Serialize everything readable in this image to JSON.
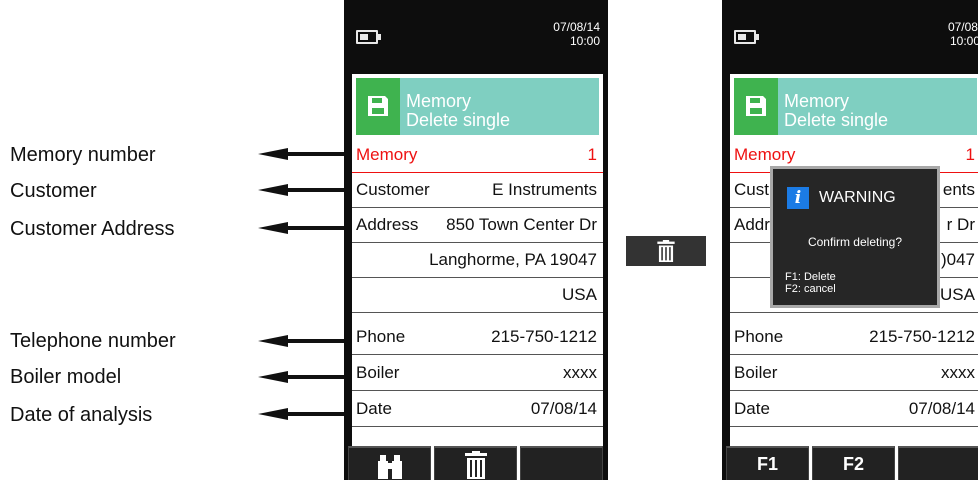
{
  "labels": [
    "Memory number",
    "Customer",
    "Customer Address",
    "Telephone number",
    "Boiler model",
    "Date of analysis"
  ],
  "left_device": {
    "date": "07/08/14",
    "time": "10:00",
    "header_line1": "Memory",
    "header_line2": "Delete single",
    "rows": [
      {
        "key": "Memory",
        "value": "1"
      },
      {
        "key": "Customer",
        "value": "E Instruments"
      },
      {
        "key": "Address",
        "value": "850 Town Center Dr"
      },
      {
        "key": "",
        "value": "Langhorme, PA  19047"
      },
      {
        "key": "",
        "value": "USA"
      },
      {
        "key": "Phone",
        "value": "215-750-1212"
      },
      {
        "key": "Boiler",
        "value": "xxxx"
      },
      {
        "key": "Date",
        "value": "07/08/14"
      }
    ],
    "softkeys": [
      "binoculars-icon",
      "trash-icon",
      ""
    ]
  },
  "middle_button": {
    "icon": "trash-icon"
  },
  "right_device": {
    "date": "07/08/1",
    "time": "10:00",
    "header_line1": "Memory",
    "header_line2": "Delete single",
    "rows": [
      {
        "key": "Memory",
        "value": "1"
      },
      {
        "key": "Cust",
        "value": "ents"
      },
      {
        "key": "Addr",
        "value": "r Dr"
      },
      {
        "key": "",
        "value": ")047"
      },
      {
        "key": "",
        "value": "USA"
      },
      {
        "key": "Phone",
        "value": "215-750-1212"
      },
      {
        "key": "Boiler",
        "value": "xxxx"
      },
      {
        "key": "Date",
        "value": "07/08/14"
      }
    ],
    "softkeys": [
      "F1",
      "F2",
      ""
    ],
    "dialog": {
      "icon": "i",
      "title": "WARNING",
      "message": "Confirm deleting?",
      "option1": "F1: Delete",
      "option2": "F2: cancel"
    }
  },
  "colors": {
    "header": "#7fcfc1",
    "save_icon_bg": "#3fb34f",
    "memory_row": "#ee1111",
    "info_icon": "#1b7be5",
    "device_body": "#0d0d0d"
  }
}
